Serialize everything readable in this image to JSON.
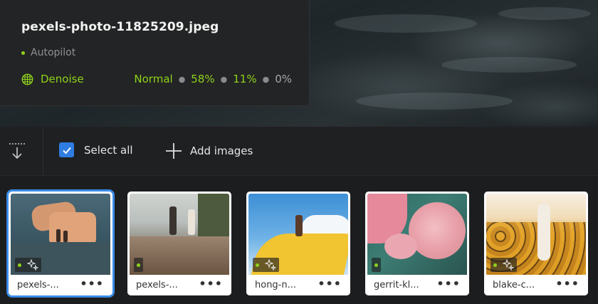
{
  "info": {
    "filename": "pexels-photo-11825209.jpeg",
    "mode": "Autopilot",
    "filter": "Denoise",
    "stats": [
      "Normal",
      "58%",
      "11%",
      "0%"
    ]
  },
  "toolbar": {
    "select_all": "Select all",
    "add_images": "Add images"
  },
  "thumbnails": [
    {
      "name": "pexels-...",
      "more": "•••",
      "selected": true,
      "ai_badge": true
    },
    {
      "name": "pexels-...",
      "more": "•••",
      "selected": false,
      "ai_badge": false
    },
    {
      "name": "hong-n...",
      "more": "•••",
      "selected": false,
      "ai_badge": true
    },
    {
      "name": "gerrit-kl...",
      "more": "•••",
      "selected": false,
      "ai_badge": false
    },
    {
      "name": "blake-c...",
      "more": "•••",
      "selected": false,
      "ai_badge": true
    }
  ],
  "colors": {
    "accent_green": "#8ed21b",
    "selection_blue": "#3a8be8",
    "checkbox_blue": "#2f7de1"
  },
  "icons": [
    "denoise-globe-icon",
    "sort-down-icon",
    "checkmark-icon",
    "plus-icon",
    "sparkle-icon",
    "more-dots-icon"
  ]
}
